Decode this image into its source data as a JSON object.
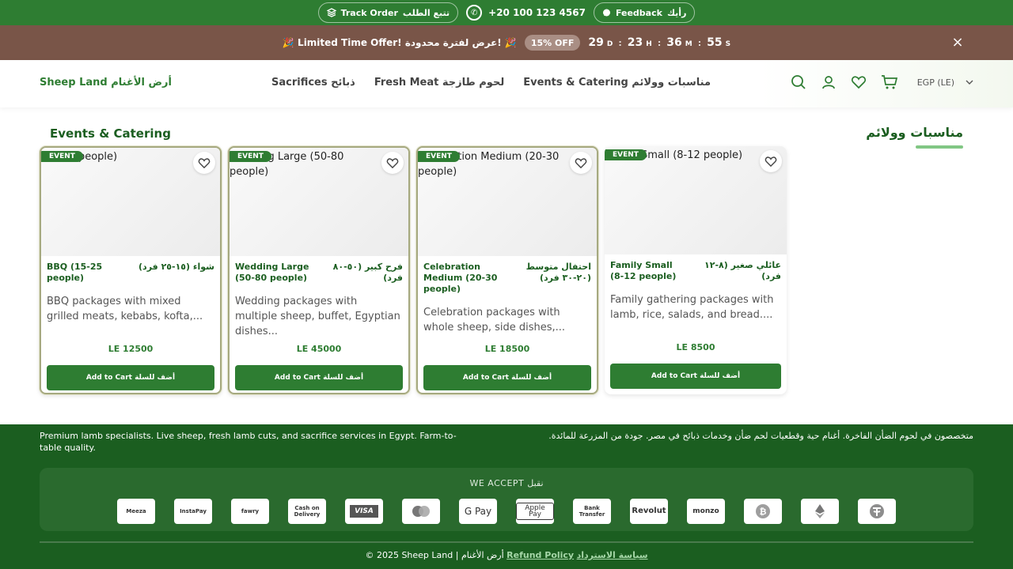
{
  "topbar": {
    "feedback_label": "Feedback",
    "feedback_ar": "رأيك",
    "phone": "+20 100 123 4567",
    "track_label": "Track Order",
    "track_ar": "تتبع الطلب"
  },
  "promo": {
    "text": "🎉 Limited Time Offer!  عرض لفترة محدودة! 🎉",
    "badge": "15% OFF",
    "countdown": {
      "days": "29",
      "d": "D",
      "hours": "23",
      "h": "H",
      "minutes": "36",
      "m": "M",
      "seconds": "55",
      "s": "S"
    },
    "close": "×"
  },
  "header": {
    "logo": "Sheep Land  أرض الأغنام",
    "nav": [
      "Sacrifices  ذبائح",
      "Fresh Meat  لحوم طازجة",
      "Events & Catering  مناسبات وولائم"
    ],
    "currency": "EGP (LE)"
  },
  "section": {
    "title_en": "Events & Catering",
    "title_ar": "مناسبات وولائم"
  },
  "cards": [
    {
      "alt": "(15-25 people)",
      "badge": "EVENT",
      "name_en": "BBQ (15-25 people)",
      "name_ar": "شواء (١٥-٢٥ فرد)",
      "desc": "BBQ packages with mixed grilled meats, kebabs, kofta,...",
      "price": "LE 12500",
      "button": "Add to Cart  أضف للسلة"
    },
    {
      "alt": "Wedding Large (50-80 people)",
      "badge": "EVENT",
      "name_en": "Wedding Large (50-80 people)",
      "name_ar": "فرح كبير (٥٠-٨٠ فرد)",
      "desc": "Wedding packages with multiple sheep, buffet, Egyptian dishes...",
      "price": "LE 45000",
      "button": "Add to Cart  أضف للسلة"
    },
    {
      "alt": "Celebration Medium (20-30 people)",
      "badge": "EVENT",
      "name_en": "Celebration Medium (20-30 people)",
      "name_ar": "احتفال متوسط (٢٠-٣٠ فرد)",
      "desc": "Celebration packages with whole sheep, side dishes,...",
      "price": "LE 18500",
      "button": "Add to Cart  أضف للسلة"
    },
    {
      "alt": "Family Small (8-12 people)",
      "badge": "EVENT",
      "name_en": "Family Small (8-12 people)",
      "name_ar": "عائلي صغير (٨-١٢ فرد)",
      "desc": "Family gathering packages with lamb, rice, salads, and bread....",
      "price": "LE 8500",
      "button": "Add to Cart  أضف للسلة"
    }
  ],
  "footer": {
    "about_en": "Premium lamb specialists. Live sheep, fresh lamb cuts, and sacrifice services in Egypt. Farm-to-table quality.",
    "about_ar": "متخصصون في لحوم الضأن الفاخرة. أغنام حية وقطعيات لحم ضأن وخدمات ذبائح في مصر. جودة من المزرعة للمائدة.",
    "accept_title": "WE ACCEPT  نقبل",
    "payments": [
      "Meeza",
      "InstaPay",
      "fawry",
      "Cash on Delivery",
      "VISA",
      "Mastercard",
      "G Pay",
      "Apple Pay",
      "Bank Transfer",
      "Revolut",
      "monzo",
      "Bitcoin",
      "Ethereum",
      "Tether"
    ],
    "copyright": "© 2025 Sheep Land | أرض الأغنام",
    "refund": "Refund Policy",
    "refund_ar": "سياسة الاسترداد"
  }
}
